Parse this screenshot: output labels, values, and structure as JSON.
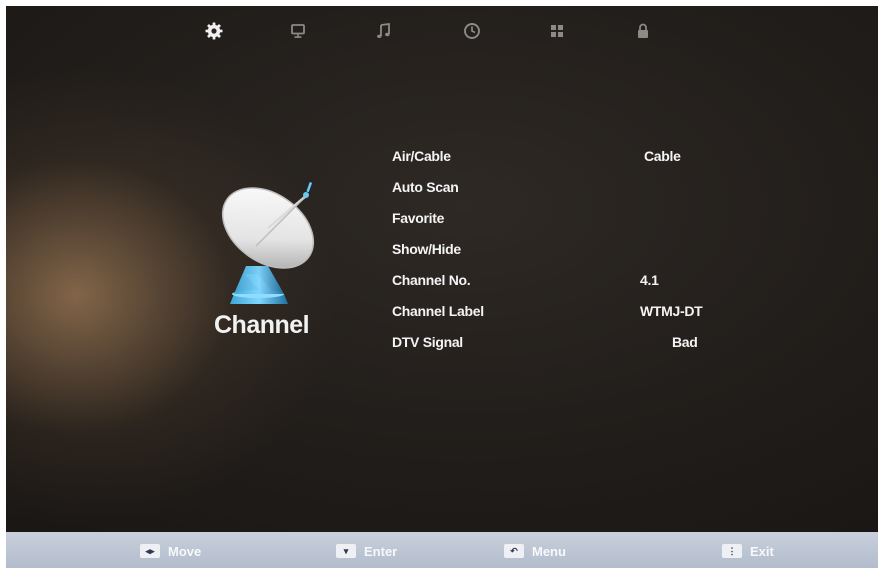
{
  "tabs": [
    {
      "icon": "gear-icon",
      "active": true
    },
    {
      "icon": "monitor-icon",
      "active": false
    },
    {
      "icon": "music-note-icon",
      "active": false
    },
    {
      "icon": "clock-icon",
      "active": false
    },
    {
      "icon": "grid-icon",
      "active": false
    },
    {
      "icon": "lock-icon",
      "active": false
    }
  ],
  "hero": {
    "icon": "satellite-dish-icon",
    "title": "Channel"
  },
  "menu": {
    "items": [
      {
        "label": "Air/Cable",
        "value": "Cable"
      },
      {
        "label": "Auto Scan",
        "value": ""
      },
      {
        "label": "Favorite",
        "value": ""
      },
      {
        "label": "Show/Hide",
        "value": ""
      },
      {
        "label": "Channel No.",
        "value": "4.1"
      },
      {
        "label": "Channel Label",
        "value": "WTMJ-DT"
      },
      {
        "label": "DTV Signal",
        "value": "Bad"
      }
    ]
  },
  "hints": {
    "move": {
      "key": "◂▸",
      "label": "Move"
    },
    "enter": {
      "key": "▾",
      "label": "Enter"
    },
    "menu": {
      "key": "↶",
      "label": "Menu"
    },
    "exit": {
      "key": "⋮",
      "label": "Exit"
    }
  },
  "colors": {
    "background": "#221e1b",
    "text": "#f4f4f4",
    "bottom_bar": "#bcc4d2"
  }
}
